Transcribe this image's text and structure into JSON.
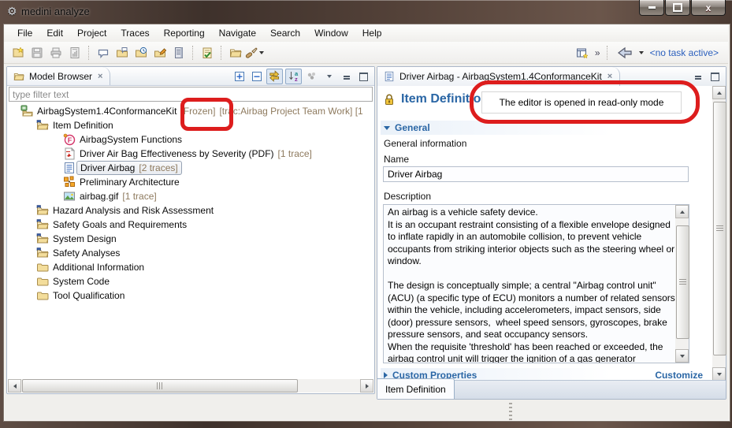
{
  "window": {
    "title": "medini analyze"
  },
  "menubar": {
    "items": [
      "File",
      "Edit",
      "Project",
      "Traces",
      "Reporting",
      "Navigate",
      "Search",
      "Window",
      "Help"
    ]
  },
  "toolbar": {
    "overflow": "»",
    "task": "<no task active>"
  },
  "model_browser": {
    "tab": "Model Browser",
    "filter": "type filter text",
    "tree": [
      {
        "label": "AirbagSystem1.4ConformanceKit",
        "deco1": "[Frozen]",
        "deco2": "[trac:Airbag Project Team Work] [1"
      },
      {
        "label": "Item Definition"
      },
      {
        "label": "AirbagSystem Functions"
      },
      {
        "label": "Driver Air Bag Effectiveness by Severity (PDF)",
        "deco": "[1 trace]"
      },
      {
        "label": "Driver Airbag",
        "deco": "[2 traces]"
      },
      {
        "label": "Preliminary Architecture"
      },
      {
        "label": "airbag.gif",
        "deco": "[1 trace]"
      },
      {
        "label": "Hazard Analysis and Risk Assessment"
      },
      {
        "label": "Safety Goals and Requirements"
      },
      {
        "label": "System Design"
      },
      {
        "label": "Safety Analyses"
      },
      {
        "label": "Additional Information"
      },
      {
        "label": "System Code"
      },
      {
        "label": "Tool Qualification"
      }
    ]
  },
  "editor": {
    "tab": "Driver Airbag - AirbagSystem1.4ConformanceKit",
    "heading": "Item Definition",
    "readonly_message": "The editor is opened in read-only mode",
    "general": {
      "title": "General",
      "subtitle": "General information",
      "name_label": "Name",
      "name_value": "Driver Airbag",
      "description_label": "Description",
      "description_value": "An airbag is a vehicle safety device.\nIt is an occupant restraint consisting of a flexible envelope designed to inflate rapidly in an automobile collision, to prevent vehicle occupants from striking interior objects such as the steering wheel or window.\n\nThe design is conceptually simple; a central \"Airbag control unit\" (ACU) (a specific type of ECU) monitors a number of related sensors within the vehicle, including accelerometers, impact sensors, side (door) pressure sensors,  wheel speed sensors, gyroscopes, brake pressure sensors, and seat occupancy sensors.\nWhen the requisite 'threshold' has been reached or exceeded, the airbag control unit will trigger the ignition of a gas generator"
    },
    "custom_properties": {
      "title": "Custom Properties",
      "action": "Customize"
    },
    "bottom_tab": "Item Definition"
  },
  "colors": {
    "annotation": "#dd1d1d",
    "decoration": "#8e7a5e",
    "section_title": "#2a66a5"
  }
}
